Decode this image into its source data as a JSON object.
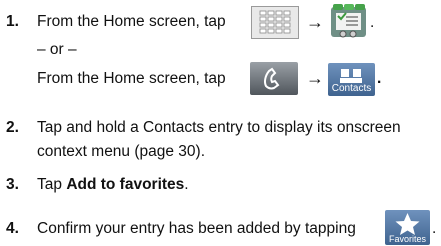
{
  "steps": [
    {
      "num": "1.",
      "text": "From the Home screen, tap",
      "trail": "."
    },
    {
      "or": "– or –"
    },
    {
      "text": "From the Home screen, tap",
      "trail": "."
    },
    {
      "num": "2.",
      "line1": "Tap and hold a Contacts entry to display its onscreen",
      "line2": "context menu (page 30)."
    },
    {
      "num": "3.",
      "pre": "Tap ",
      "bold": "Add to favorites",
      "post": "."
    },
    {
      "num": "4.",
      "text": "Confirm your entry has been added by tapping",
      "trail": "."
    }
  ],
  "arrow": "→",
  "icons": {
    "apps": "apps-grid-icon",
    "settings": "settings-icon",
    "phone": "phone-icon",
    "contacts": "contacts-icon",
    "favorites": "favorites-star-icon"
  },
  "labels": {
    "contacts": "Contacts",
    "favorites": "Favorites"
  }
}
